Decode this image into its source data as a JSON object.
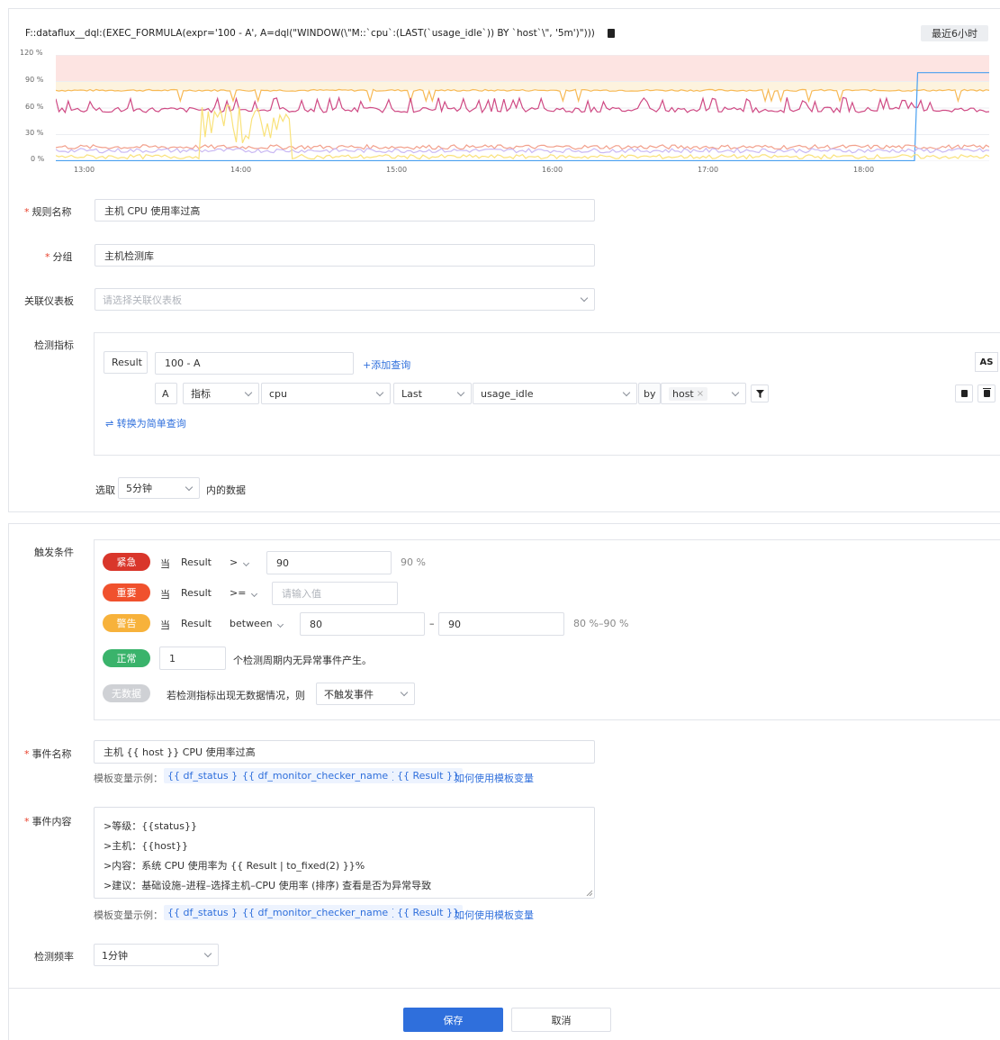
{
  "chart": {
    "query": "F::dataflux__dql:(EXEC_FORMULA(expr='100 - A', A=dql(\"WINDOW(\\\"M::`cpu`:(LAST(`usage_idle`)) BY `host`\\\", '5m')\")))",
    "time_range_button": "最近6小时",
    "y_ticks": [
      "120 %",
      "90 %",
      "60 %",
      "30 %",
      "0 %"
    ],
    "x_ticks": [
      "13:00",
      "14:00",
      "15:00",
      "16:00",
      "17:00",
      "18:00"
    ]
  },
  "chart_data": {
    "type": "line",
    "x_ticks": [
      "13:00",
      "14:00",
      "15:00",
      "16:00",
      "17:00",
      "18:00"
    ],
    "ylim": [
      0,
      120
    ],
    "y_unit": "%",
    "threshold_bands": [
      {
        "from": 90,
        "to": 120,
        "color": "#fde4e2"
      },
      {
        "from": 80,
        "to": 90,
        "color": "#fdf3de"
      }
    ],
    "series": [
      {
        "color": "#f7b955",
        "baseline": 80
      },
      {
        "color": "#cf4a84",
        "baseline": 58
      },
      {
        "color": "#4aa0f0",
        "baseline": 0,
        "step_to": 100
      },
      {
        "color": "#f2a08c",
        "baseline": 16
      },
      {
        "color": "#c9b8f3",
        "baseline": 12
      },
      {
        "color": "#f9e27a",
        "baseline": 5
      }
    ]
  },
  "rule_name": {
    "label": "规则名称",
    "value": "主机 CPU 使用率过高"
  },
  "group": {
    "label": "分组",
    "value": "主机检测库"
  },
  "dashboard": {
    "label": "关联仪表板",
    "placeholder": "请选择关联仪表板"
  },
  "metric": {
    "label": "检测指标",
    "result_label": "Result",
    "result_expr": "100 - A",
    "add_query": "+添加查询",
    "as_button": "AS",
    "query_a": {
      "name": "A",
      "type": "指标",
      "measurement": "cpu",
      "func": "Last",
      "field": "usage_idle",
      "by": "by",
      "by_tag": "host"
    },
    "switch_simple": "转换为简单查询"
  },
  "window": {
    "prefix": "选取",
    "value": "5分钟",
    "suffix": "内的数据"
  },
  "trigger": {
    "label": "触发条件",
    "when": "当",
    "result": "Result",
    "critical": {
      "tag": "紧急",
      "op": ">",
      "value": "90",
      "hint": "90 %"
    },
    "important": {
      "tag": "重要",
      "op": ">=",
      "placeholder": "请输入值"
    },
    "warning": {
      "tag": "警告",
      "op": "between",
      "from": "80",
      "dash": "–",
      "to": "90",
      "hint": "80 %–90 %"
    },
    "normal": {
      "tag": "正常",
      "value": "1",
      "text": "个检测周期内无异常事件产生。"
    },
    "nodata": {
      "tag": "无数据",
      "text": "若检测指标出现无数据情况，则",
      "select": "不触发事件"
    }
  },
  "event_name": {
    "label": "事件名称",
    "value": "主机 {{ host }} CPU 使用率过高",
    "vars_prefix": "模板变量示例：",
    "vars": [
      "{{ df_status }}",
      "{{ df_monitor_checker_name }}",
      "{{ Result }}"
    ],
    "help_link": "如何使用模板变量"
  },
  "event_content": {
    "label": "事件内容",
    "lines": [
      ">等级：{{status}}",
      ">主机：{{host}}",
      ">内容：系统 CPU 使用率为 {{ Result | to_fixed(2) }}%",
      ">建议：基础设施–进程–选择主机–CPU 使用率 (排序) 查看是否为异常导致"
    ],
    "vars_prefix": "模板变量示例：",
    "vars": [
      "{{ df_status }}",
      "{{ df_monitor_checker_name }}",
      "{{ Result }}"
    ],
    "help_link": "如何使用模板变量"
  },
  "frequency": {
    "label": "检测频率",
    "value": "1分钟"
  },
  "buttons": {
    "save": "保存",
    "cancel": "取消"
  },
  "colors": {
    "critical": "#d9362b",
    "important": "#f0512d",
    "warning": "#f7b23b",
    "normal": "#3ab36b",
    "nodata": "#cfd1d5",
    "primary": "#2f6fdc"
  }
}
